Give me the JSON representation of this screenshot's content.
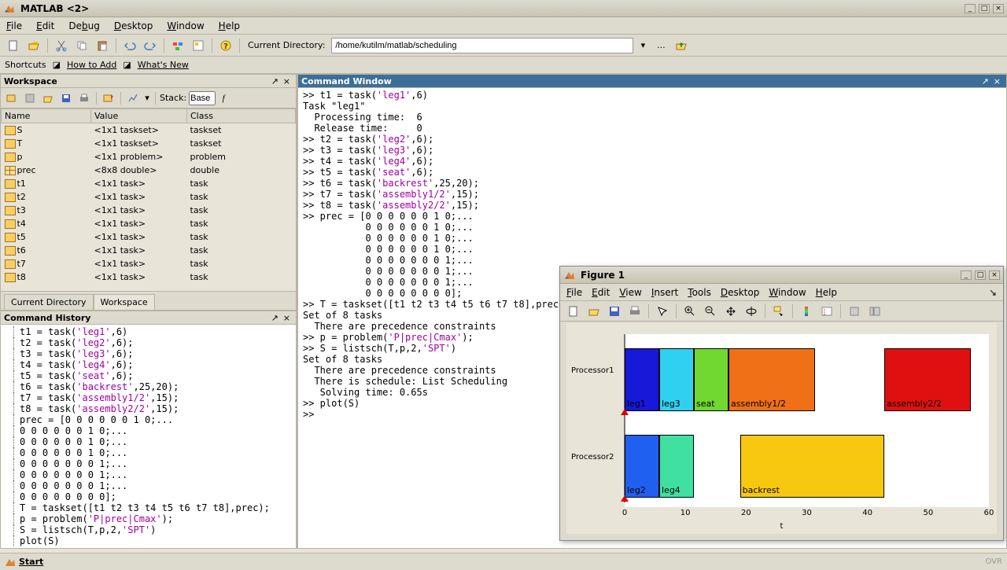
{
  "window": {
    "title": "MATLAB <2>"
  },
  "menu": {
    "file": "File",
    "edit": "Edit",
    "debug": "Debug",
    "desktop": "Desktop",
    "window": "Window",
    "help": "Help"
  },
  "toolbar": {
    "cur_dir_label": "Current Directory:",
    "cur_dir_value": "/home/kutilm/matlab/scheduling"
  },
  "shortcut": {
    "label": "Shortcuts",
    "howto": "How to Add",
    "whatsnew": "What's New"
  },
  "workspace": {
    "title": "Workspace",
    "stack_label": "Stack:",
    "stack_value": "Base",
    "cols": {
      "name": "Name",
      "value": "Value",
      "class": "Class"
    },
    "rows": [
      {
        "name": "S",
        "value": "<1x1 taskset>",
        "class": "taskset",
        "icon": "obj"
      },
      {
        "name": "T",
        "value": "<1x1 taskset>",
        "class": "taskset",
        "icon": "obj"
      },
      {
        "name": "p",
        "value": "<1x1 problem>",
        "class": "problem",
        "icon": "obj"
      },
      {
        "name": "prec",
        "value": "<8x8 double>",
        "class": "double",
        "icon": "grid"
      },
      {
        "name": "t1",
        "value": "<1x1 task>",
        "class": "task",
        "icon": "obj"
      },
      {
        "name": "t2",
        "value": "<1x1 task>",
        "class": "task",
        "icon": "obj"
      },
      {
        "name": "t3",
        "value": "<1x1 task>",
        "class": "task",
        "icon": "obj"
      },
      {
        "name": "t4",
        "value": "<1x1 task>",
        "class": "task",
        "icon": "obj"
      },
      {
        "name": "t5",
        "value": "<1x1 task>",
        "class": "task",
        "icon": "obj"
      },
      {
        "name": "t6",
        "value": "<1x1 task>",
        "class": "task",
        "icon": "obj"
      },
      {
        "name": "t7",
        "value": "<1x1 task>",
        "class": "task",
        "icon": "obj"
      },
      {
        "name": "t8",
        "value": "<1x1 task>",
        "class": "task",
        "icon": "obj"
      }
    ],
    "tabs": {
      "curdir": "Current Directory",
      "workspace": "Workspace"
    }
  },
  "cmd_history": {
    "title": "Command History",
    "lines": [
      "t1 = task('leg1',6)",
      "t2 = task('leg2',6);",
      "t3 = task('leg3',6);",
      "t4 = task('leg4',6);",
      "t5 = task('seat',6);",
      "t6 = task('backrest',25,20);",
      "t7 = task('assembly1/2',15);",
      "t8 = task('assembly2/2',15);",
      "prec = [0 0 0 0 0 0 1 0;...",
      "0 0 0 0 0 0 1 0;...",
      "0 0 0 0 0 0 1 0;...",
      "0 0 0 0 0 0 1 0;...",
      "0 0 0 0 0 0 0 1;...",
      "0 0 0 0 0 0 0 1;...",
      "0 0 0 0 0 0 0 1;...",
      "0 0 0 0 0 0 0 0];",
      "T = taskset([t1 t2 t3 t4 t5 t6 t7 t8],prec);",
      "p = problem('P|prec|Cmax');",
      "S = listsch(T,p,2,'SPT')",
      "plot(S)"
    ]
  },
  "cmd_window": {
    "title": "Command Window"
  },
  "figure": {
    "title": "Figure 1",
    "menu": {
      "file": "File",
      "edit": "Edit",
      "view": "View",
      "insert": "Insert",
      "tools": "Tools",
      "desktop": "Desktop",
      "window": "Window",
      "help": "Help"
    },
    "proc1_label": "Processor1",
    "proc2_label": "Processor2",
    "t_label": "t",
    "ticks": [
      "0",
      "10",
      "20",
      "30",
      "40",
      "50",
      "60"
    ],
    "tasks": [
      {
        "label": "leg1",
        "proc": 1,
        "start": 0,
        "end": 6,
        "color": "#1818D8"
      },
      {
        "label": "leg3",
        "proc": 1,
        "start": 6,
        "end": 12,
        "color": "#30D0F0"
      },
      {
        "label": "seat",
        "proc": 1,
        "start": 12,
        "end": 18,
        "color": "#70D830"
      },
      {
        "label": "assembly1/2",
        "proc": 1,
        "start": 18,
        "end": 33,
        "color": "#F07018"
      },
      {
        "label": "assembly2/2",
        "proc": 1,
        "start": 45,
        "end": 60,
        "color": "#E01010"
      },
      {
        "label": "leg2",
        "proc": 2,
        "start": 0,
        "end": 6,
        "color": "#2060F0"
      },
      {
        "label": "leg4",
        "proc": 2,
        "start": 6,
        "end": 12,
        "color": "#40E0A0"
      },
      {
        "label": "backrest",
        "proc": 2,
        "start": 20,
        "end": 45,
        "color": "#F8C810"
      }
    ]
  },
  "chart_data": {
    "type": "gantt",
    "title": "Figure 1",
    "xlabel": "t",
    "xlim": [
      0,
      60
    ],
    "xticks": [
      0,
      10,
      20,
      30,
      40,
      50,
      60
    ],
    "rows": [
      "Processor1",
      "Processor2"
    ],
    "tasks": [
      {
        "name": "leg1",
        "row": "Processor1",
        "start": 0,
        "end": 6
      },
      {
        "name": "leg3",
        "row": "Processor1",
        "start": 6,
        "end": 12
      },
      {
        "name": "seat",
        "row": "Processor1",
        "start": 12,
        "end": 18
      },
      {
        "name": "assembly1/2",
        "row": "Processor1",
        "start": 18,
        "end": 33
      },
      {
        "name": "assembly2/2",
        "row": "Processor1",
        "start": 45,
        "end": 60
      },
      {
        "name": "leg2",
        "row": "Processor2",
        "start": 0,
        "end": 6
      },
      {
        "name": "leg4",
        "row": "Processor2",
        "start": 6,
        "end": 12
      },
      {
        "name": "backrest",
        "row": "Processor2",
        "start": 20,
        "end": 45
      }
    ],
    "precedence": [
      [
        "leg1",
        "assembly1/2"
      ],
      [
        "leg2",
        "assembly1/2"
      ],
      [
        "leg3",
        "assembly1/2"
      ],
      [
        "leg4",
        "assembly1/2"
      ],
      [
        "seat",
        "assembly2/2"
      ],
      [
        "backrest",
        "assembly2/2"
      ],
      [
        "assembly1/2",
        "assembly2/2"
      ]
    ]
  },
  "start": {
    "label": "Start",
    "ovr": "OVR"
  }
}
